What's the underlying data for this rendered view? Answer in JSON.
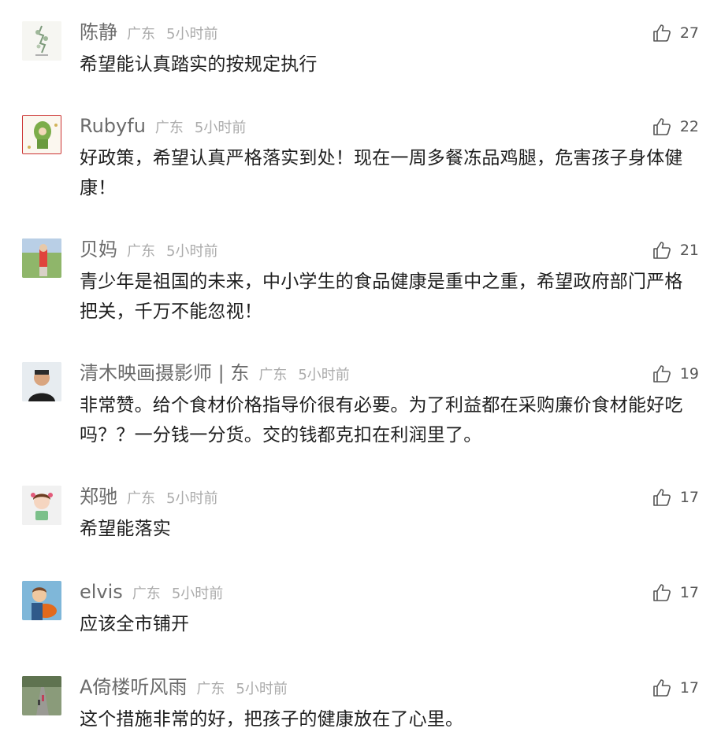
{
  "comments": [
    {
      "name": "陈静",
      "region": "广东",
      "time": "5小时前",
      "likes": "27",
      "text": "希望能认真踏实的按规定执行"
    },
    {
      "name": "Rubyfu",
      "region": "广东",
      "time": "5小时前",
      "likes": "22",
      "text": "好政策，希望认真严格落实到处！现在一周多餐冻品鸡腿，危害孩子身体健康！"
    },
    {
      "name": "贝妈",
      "region": "广东",
      "time": "5小时前",
      "likes": "21",
      "text": "青少年是祖国的未来，中小学生的食品健康是重中之重，希望政府部门严格把关，千万不能忽视！"
    },
    {
      "name": "清木映画摄影师 | 东",
      "region": "广东",
      "time": "5小时前",
      "likes": "19",
      "text": "非常赞。给个食材价格指导价很有必要。为了利益都在采购廉价食材能好吃吗？？一分钱一分货。交的钱都克扣在利润里了。"
    },
    {
      "name": "郑驰",
      "region": "广东",
      "time": "5小时前",
      "likes": "17",
      "text": "希望能落实"
    },
    {
      "name": "elvis",
      "region": "广东",
      "time": "5小时前",
      "likes": "17",
      "text": "应该全市铺开"
    },
    {
      "name": "A倚楼听风雨",
      "region": "广东",
      "time": "5小时前",
      "likes": "17",
      "text": "这个措施非常的好，把孩子的健康放在了心里。"
    }
  ],
  "icons": {
    "like": "thumbs-up-icon"
  },
  "colors": {
    "name": "#6b6b6b",
    "meta": "#ababab",
    "text": "#1f1f1f",
    "icon": "#555555"
  }
}
